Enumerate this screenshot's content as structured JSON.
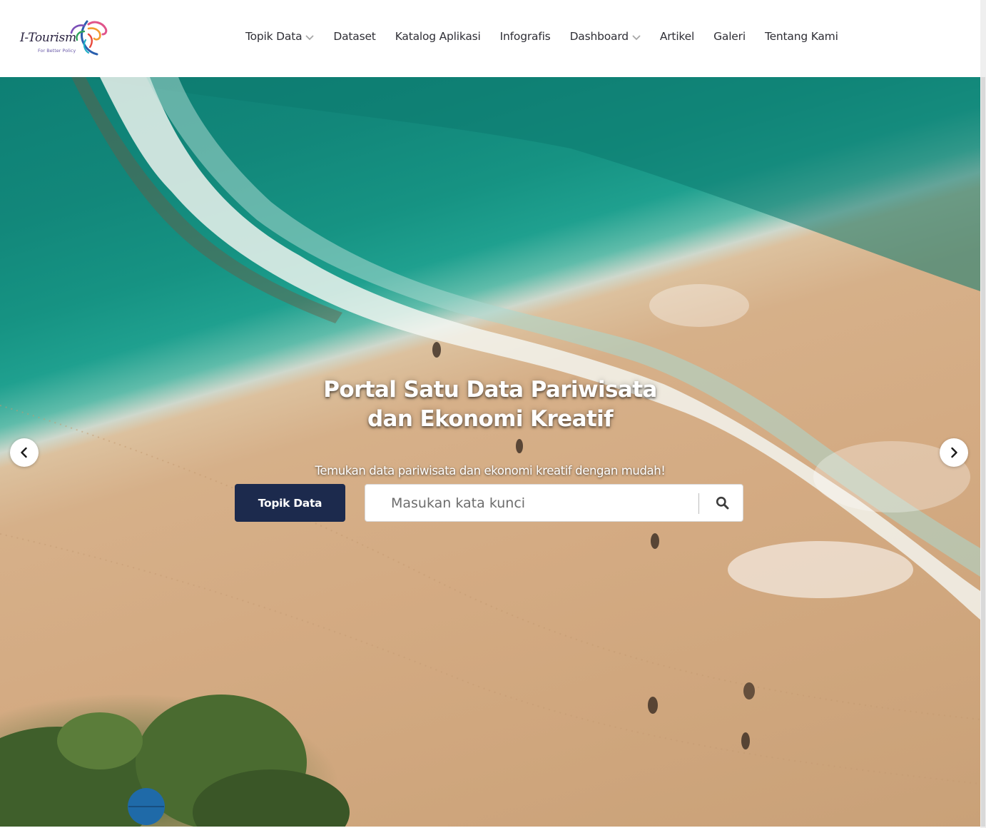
{
  "brand": {
    "logo_text": "I-Tourism",
    "tagline": "For Better Policy",
    "logo_icon": "phoenix-bird-logo-icon"
  },
  "nav": {
    "items": [
      {
        "label": "Topik Data",
        "has_dropdown": true
      },
      {
        "label": "Dataset",
        "has_dropdown": false
      },
      {
        "label": "Katalog Aplikasi",
        "has_dropdown": false
      },
      {
        "label": "Infografis",
        "has_dropdown": false
      },
      {
        "label": "Dashboard",
        "has_dropdown": true
      },
      {
        "label": "Artikel",
        "has_dropdown": false
      },
      {
        "label": "Galeri",
        "has_dropdown": false
      },
      {
        "label": "Tentang Kami",
        "has_dropdown": false
      }
    ],
    "dropdown_icon": "chevron-down-icon"
  },
  "hero": {
    "background": "aerial beach photo: turquoise sea, white surf, sand, trees, umbrella",
    "title_line1": "Portal Satu Data Pariwisata",
    "title_line2": "dan Ekonomi Kreatif",
    "subtitle": "Temukan data pariwisata dan ekonomi kreatif dengan mudah!",
    "topic_button_label": "Topik Data",
    "search": {
      "placeholder": "Masukan kata kunci",
      "value": "",
      "button_icon": "search-icon"
    },
    "carousel": {
      "prev_icon": "chevron-left-icon",
      "next_icon": "chevron-right-icon"
    }
  },
  "colors": {
    "primary_button": "#1c2a4d",
    "nav_text": "#2f2f36",
    "sea": "#16907f",
    "sand": "#d4ab83"
  }
}
